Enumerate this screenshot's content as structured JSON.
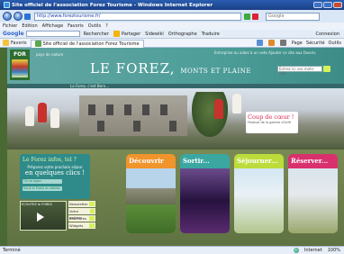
{
  "window": {
    "title": "Site officiel de l'association Forez Tourisme - Windows Internet Explorer"
  },
  "address_bar": {
    "url": "http://www.foreztourisme.fr/",
    "search_placeholder": "Google"
  },
  "menu": [
    "Fichier",
    "Edition",
    "Affichage",
    "Favoris",
    "Outils",
    "?"
  ],
  "google_toolbar": {
    "label": "Google",
    "items": [
      "Rechercher",
      "Partager",
      "Sidewiki",
      "Orthographe",
      "Traduire",
      "Connexion"
    ]
  },
  "tabs": {
    "favorites": "Favoris",
    "active_tab": "Site officiel de l'association Forez Tourisme",
    "tools": [
      "Page",
      "Sécurité",
      "Outils"
    ]
  },
  "site": {
    "logo": "FOR",
    "tagline": "pays de nature",
    "brand": "LE FOREZ,",
    "brand_sub": "MONTS ET PLAINE",
    "header_links": "Entreprise ou aides à un veto   Ajouter ce site aux favoris",
    "search_placeholder": "Entrez ici vos mots-clés",
    "topstrip": "La Forez, c'est Bern...",
    "coup_de_coeur_title": "Coup de cœur !",
    "coup_de_coeur_text": "Festival de la galerie d'Urfé",
    "info_title": "Le Forez infos, tel ?",
    "info_sub": "Préparez votre prochain séjour",
    "info_main": "en quelques clics !",
    "input1": "Où se loger",
    "input2": "Sous le Forez en tables",
    "video_label": "ECOUTEZ le FOREZ",
    "mini_links": [
      "Newsletter",
      "Votre partner",
      "Brochures",
      "Widgets"
    ],
    "cards": [
      {
        "title": "Découvrir"
      },
      {
        "title": "Sortir..."
      },
      {
        "title": "Séjourner..."
      },
      {
        "title": "Réserver..."
      }
    ]
  },
  "status": {
    "left": "Terminé",
    "zone": "Internet",
    "zoom": "100%"
  },
  "colors": {
    "titlebar": "#1a3f86",
    "teal": "#3aa7a1",
    "orange": "#f1942b",
    "green": "#bddc3c",
    "pink": "#d9316d"
  }
}
